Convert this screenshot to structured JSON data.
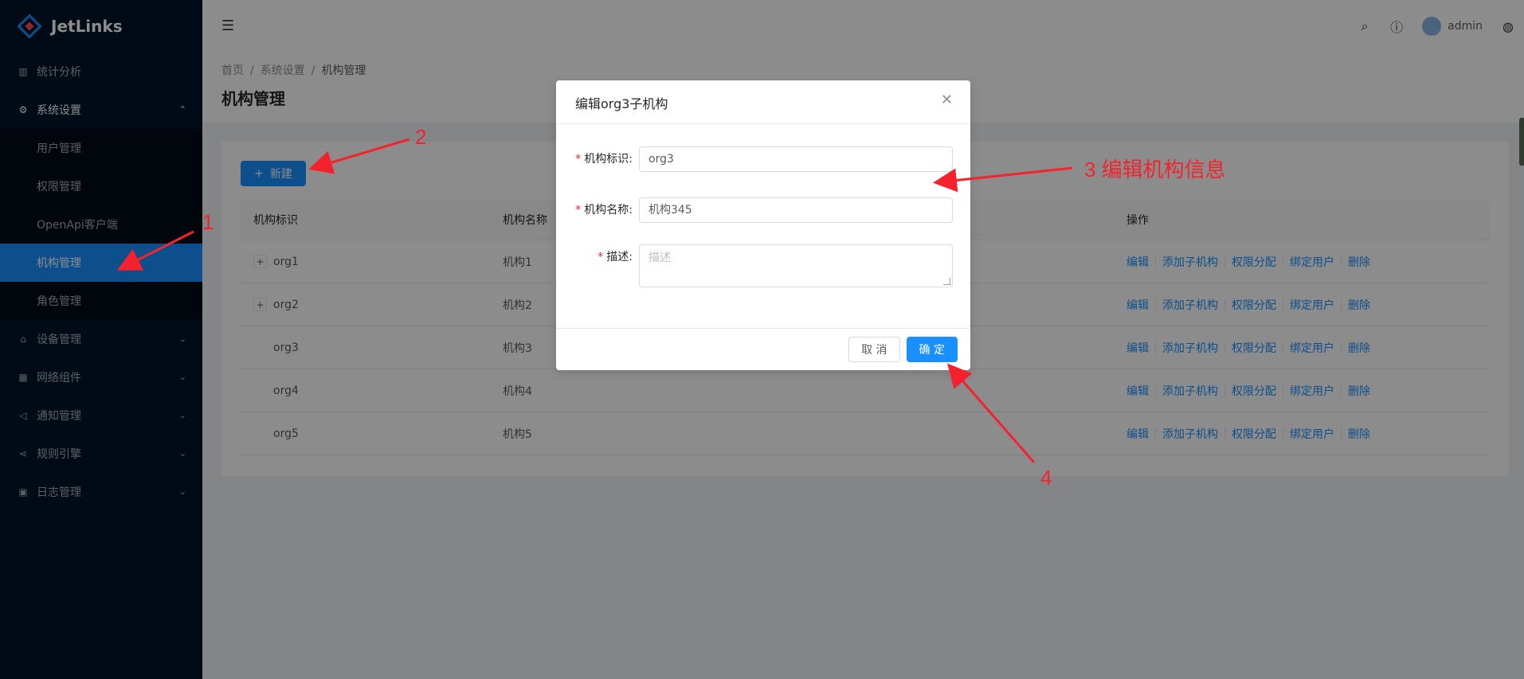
{
  "app": {
    "name": "JetLinks"
  },
  "sidebar": {
    "items": [
      {
        "label": "统计分析",
        "icon": "bar-chart-icon"
      },
      {
        "label": "系统设置",
        "icon": "settings-icon",
        "open": true,
        "children": [
          {
            "label": "用户管理"
          },
          {
            "label": "权限管理"
          },
          {
            "label": "OpenApi客户端"
          },
          {
            "label": "机构管理",
            "active": true
          },
          {
            "label": "角色管理"
          }
        ]
      },
      {
        "label": "设备管理",
        "icon": "device-icon"
      },
      {
        "label": "网络组件",
        "icon": "network-icon"
      },
      {
        "label": "通知管理",
        "icon": "notification-icon"
      },
      {
        "label": "规则引擎",
        "icon": "rule-engine-icon"
      },
      {
        "label": "日志管理",
        "icon": "log-icon"
      }
    ]
  },
  "header": {
    "user": "admin"
  },
  "breadcrumb": {
    "home": "首页",
    "parent": "系统设置",
    "current": "机构管理"
  },
  "page": {
    "title": "机构管理"
  },
  "toolbar": {
    "new_label": "新建"
  },
  "table": {
    "columns": [
      "机构标识",
      "机构名称",
      "操作"
    ],
    "rows": [
      {
        "id": "org1",
        "name": "机构1",
        "expandable": true
      },
      {
        "id": "org2",
        "name": "机构2",
        "expandable": true
      },
      {
        "id": "org3",
        "name": "机构3",
        "expandable": false
      },
      {
        "id": "org4",
        "name": "机构4",
        "expandable": false
      },
      {
        "id": "org5",
        "name": "机构5",
        "expandable": false
      }
    ],
    "actions": [
      "编辑",
      "添加子机构",
      "权限分配",
      "绑定用户",
      "删除"
    ]
  },
  "modal": {
    "title": "编辑org3子机构",
    "fields": {
      "id": {
        "label": "机构标识:",
        "value": "org3"
      },
      "name": {
        "label": "机构名称:",
        "value": "机构345"
      },
      "desc": {
        "label": "描述:",
        "placeholder": "描述"
      }
    },
    "cancel_label": "取 消",
    "ok_label": "确 定"
  },
  "annotations": {
    "a1": "1",
    "a2": "2",
    "a3": "3 编辑机构信息",
    "a4": "4"
  },
  "colors": {
    "primary": "#1890ff",
    "sidebar": "#001529",
    "annotation": "#f5222d"
  }
}
